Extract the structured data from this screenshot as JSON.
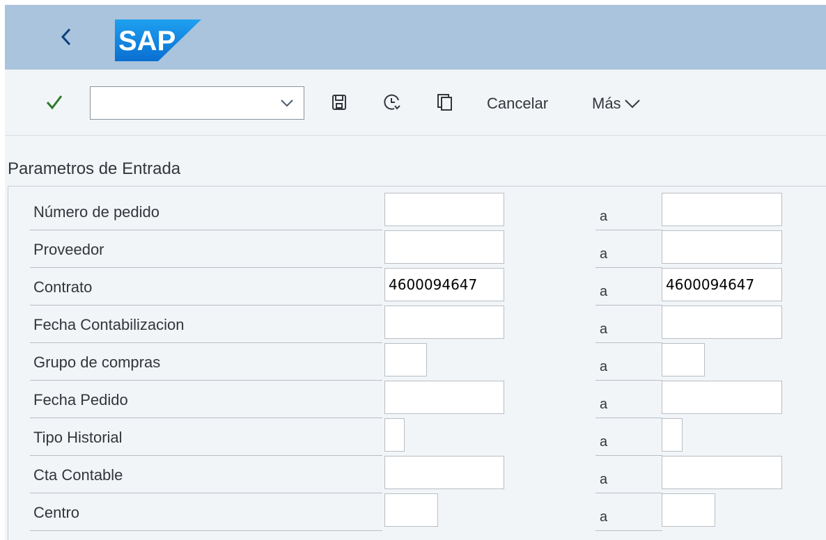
{
  "header": {
    "logo_text": "SAP",
    "back_icon": "chevron-left-icon"
  },
  "toolbar": {
    "check_icon": "checkmark-icon",
    "variant_value": "",
    "save_icon": "save-icon",
    "history_icon": "clock-icon",
    "copy_icon": "copy-icon",
    "cancel_label": "Cancelar",
    "more_label": "Más"
  },
  "section": {
    "title": "Parametros de Entrada",
    "range_separator": "a",
    "rows": [
      {
        "label": "Número de pedido",
        "from": "",
        "to": ""
      },
      {
        "label": "Proveedor",
        "from": "",
        "to": ""
      },
      {
        "label": "Contrato",
        "from": "4600094647",
        "to": "4600094647"
      },
      {
        "label": "Fecha Contabilizacion",
        "from": "",
        "to": ""
      },
      {
        "label": "Grupo de compras",
        "from": "",
        "to": ""
      },
      {
        "label": "Fecha Pedido",
        "from": "",
        "to": ""
      },
      {
        "label": "Tipo Historial",
        "from": "",
        "to": ""
      },
      {
        "label": "Cta Contable",
        "from": "",
        "to": ""
      },
      {
        "label": "Centro",
        "from": "",
        "to": ""
      }
    ]
  },
  "colors": {
    "shell_bg": "#a9c4dc",
    "sap_logo_blue": "#0a6ed1",
    "check_green": "#2b7c2b",
    "page_bg": "#f2f5f8"
  }
}
